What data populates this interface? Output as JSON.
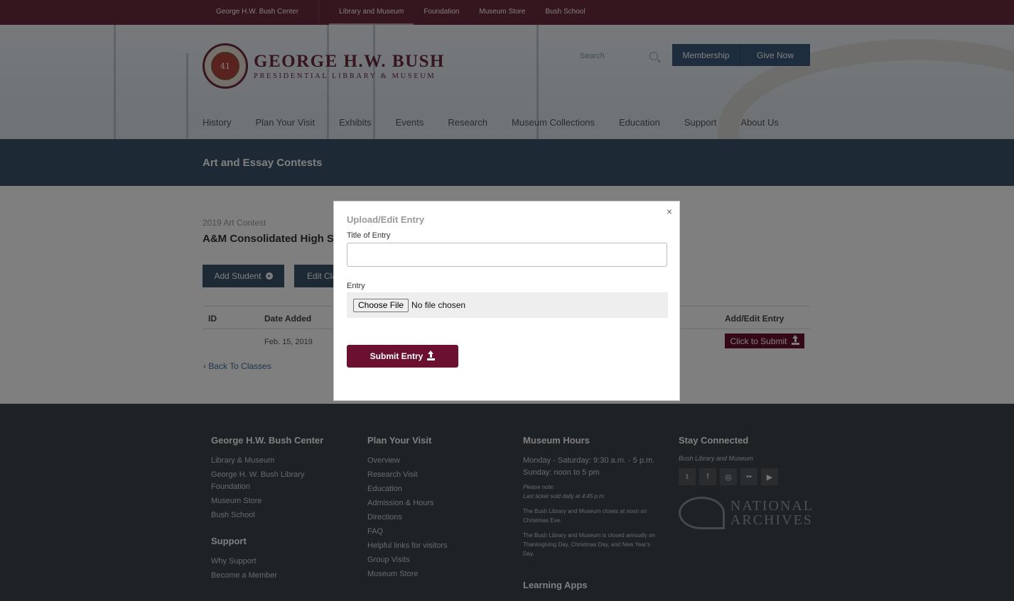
{
  "topnav": [
    "George H.W. Bush Center",
    "Library and Museum",
    "Foundation",
    "Museum Store",
    "Bush School"
  ],
  "logo": {
    "line1": "GEORGE H.W. BUSH",
    "line2": "PRESIDENTIAL LIBRARY & MUSEUM",
    "seal_text": "41"
  },
  "search": {
    "placeholder": "Search"
  },
  "header_buttons": {
    "membership": "Membership",
    "give": "Give Now"
  },
  "mainnav": [
    "History",
    "Plan Your Visit",
    "Exhibits",
    "Events",
    "Research",
    "Museum Collections",
    "Education",
    "Support",
    "About Us"
  ],
  "page_title": "Art and Essay Contests",
  "content": {
    "kicker": "2019 Art Contest",
    "school": "A&M Consolidated High S",
    "add_student": "Add Student",
    "edit_class": "Edit Cla",
    "table_headers": {
      "id": "ID",
      "date_added": "Date Added",
      "add_edit": "Add/Edit Entry"
    },
    "row": {
      "date": "Feb. 15, 2019",
      "submit": "Click to Submit"
    },
    "back": "Back To Classes"
  },
  "modal": {
    "title": "Upload/Edit Entry",
    "close": "×",
    "title_label": "Title of Entry",
    "title_value": "",
    "entry_label": "Entry",
    "choose_file": "Choose File",
    "no_file": "No file chosen",
    "submit": "Submit Entry"
  },
  "footer": {
    "col1": {
      "heading": "George H.W. Bush Center",
      "links": [
        "Library & Museum",
        "George H. W. Bush Library Foundation",
        "Museum Store",
        "Bush School"
      ],
      "heading2": "Support",
      "links2": [
        "Why Support",
        "Become a Member"
      ]
    },
    "col2": {
      "heading": "Plan Your Visit",
      "links": [
        "Overview",
        "Research Visit",
        "Education",
        "Admission & Hours",
        "Directions",
        "FAQ",
        "Helpful links for visitors",
        "Group Visits",
        "Museum Store"
      ]
    },
    "col3": {
      "heading": "Museum Hours",
      "hours1": "Monday - Saturday: 9:30 a.m. - 5 p.m.",
      "hours2": "Sunday: noon to 5 pm",
      "note1": "Please note:",
      "note2": "Last ticket sold daily at 4:45 p.m.",
      "small1": "The Bush Library and Museum closes at noon on Christmas Eve.",
      "small2": "The Bush Library and Museum is closed annually on Thanksgiving Day, Christmas Day, and New Year's Day.",
      "heading2": "Learning Apps"
    },
    "col4": {
      "heading": "Stay Connected",
      "subtitle": "Bush Library and Museum",
      "social": [
        "twitter-icon",
        "facebook-icon",
        "instagram-icon",
        "flickr-icon",
        "youtube-icon"
      ],
      "natarch1": "NATIONAL",
      "natarch2": "ARCHIVES"
    }
  }
}
